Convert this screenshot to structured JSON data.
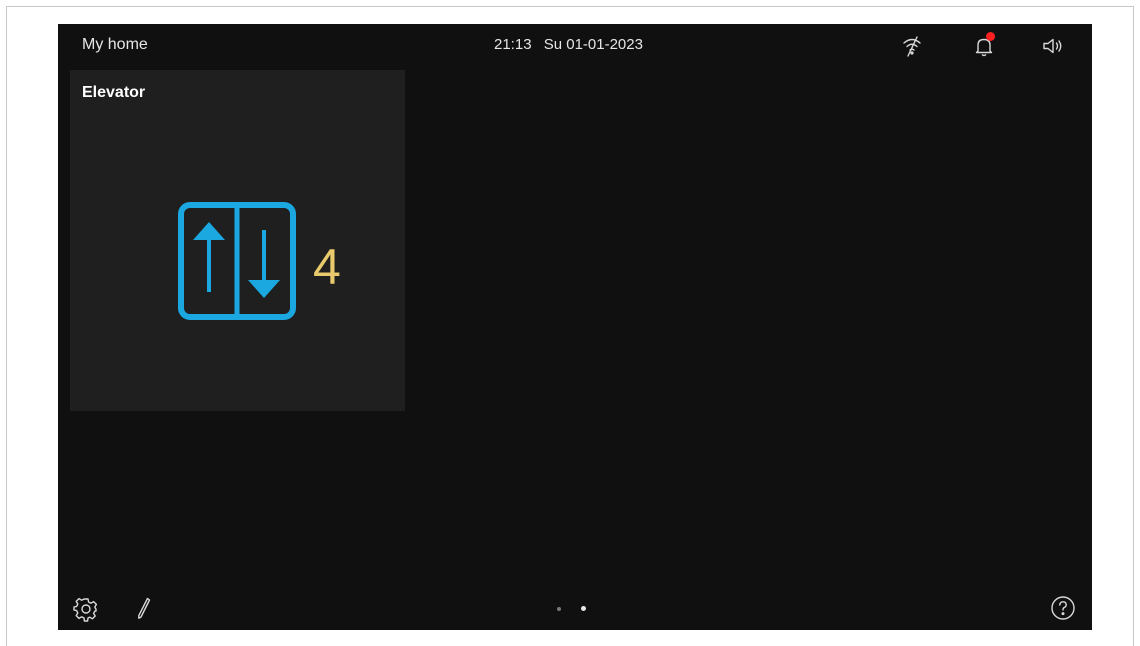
{
  "topbar": {
    "home_title": "My home",
    "time": "21:13",
    "date": "Su 01-01-2023",
    "icons": [
      "wifi-off-icon",
      "bell-icon",
      "speaker-icon"
    ],
    "notification_badge_color": "#ff2020"
  },
  "tile": {
    "title": "Elevator",
    "icon": "elevator-up-down-icon",
    "floor": "4",
    "icon_color": "#1ba8e0",
    "floor_color": "#e8c96b"
  },
  "bottombar": {
    "icons": [
      "settings-icon",
      "edit-icon",
      "help-icon"
    ],
    "pages": {
      "total": 2,
      "current": 2
    }
  }
}
